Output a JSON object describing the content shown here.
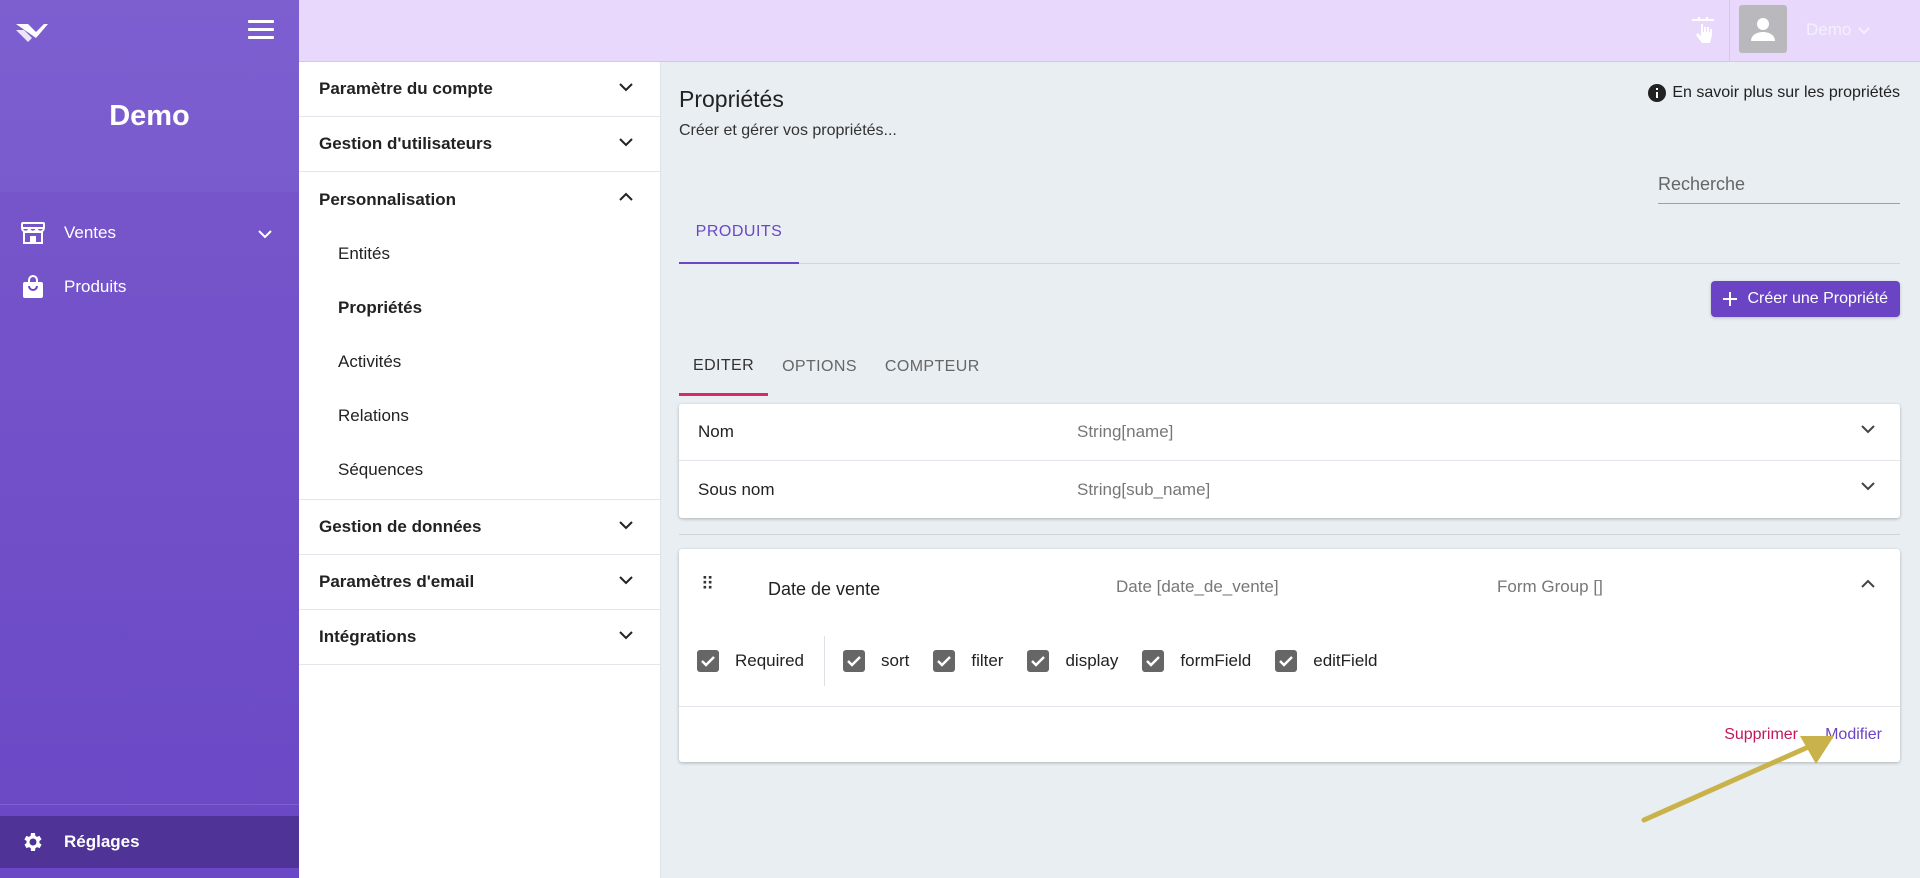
{
  "sidebar": {
    "title": "Demo",
    "items": [
      {
        "label": "Ventes",
        "icon": "store-icon"
      },
      {
        "label": "Produits",
        "icon": "shopping-bag-icon"
      }
    ],
    "bottom": {
      "label": "Réglages",
      "icon": "gear-icon"
    }
  },
  "topbar": {
    "user_name": "Demo"
  },
  "settings_menu": {
    "groups": [
      {
        "label": "Paramètre du compte"
      },
      {
        "label": "Gestion d'utilisateurs"
      },
      {
        "label": "Personnalisation"
      },
      {
        "label": "Gestion de données"
      },
      {
        "label": "Paramètres d'email"
      },
      {
        "label": "Intégrations"
      }
    ],
    "sub_items": [
      "Entités",
      "Propriétés",
      "Activités",
      "Relations",
      "Séquences"
    ]
  },
  "main": {
    "title": "Propriétés",
    "subtitle": "Créer et gérer vos propriétés...",
    "learn_more": "En savoir plus sur les propriétés",
    "search_placeholder": "Recherche",
    "tab_products": "PRODUITS",
    "create_button": "Créer une Propriété",
    "subtabs": [
      "EDITER",
      "OPTIONS",
      "COMPTEUR"
    ],
    "properties": [
      {
        "name": "Nom",
        "type": "String[name]"
      },
      {
        "name": "Sous nom",
        "type": "String[sub_name]"
      }
    ],
    "expanded": {
      "drag_handle": "⠿",
      "name": "Date de vente",
      "type": "Date [date_de_vente]",
      "group": "Form Group []",
      "checks": [
        "Required",
        "sort",
        "filter",
        "display",
        "formField",
        "editField"
      ],
      "delete_label": "Supprimer",
      "modify_label": "Modifier"
    }
  },
  "colors": {
    "accent": "#6a44c4",
    "sidebar": "#6a48c6",
    "topbar": "#e8d8fb",
    "danger": "#c2185b",
    "arrow": "#c9b24a"
  }
}
